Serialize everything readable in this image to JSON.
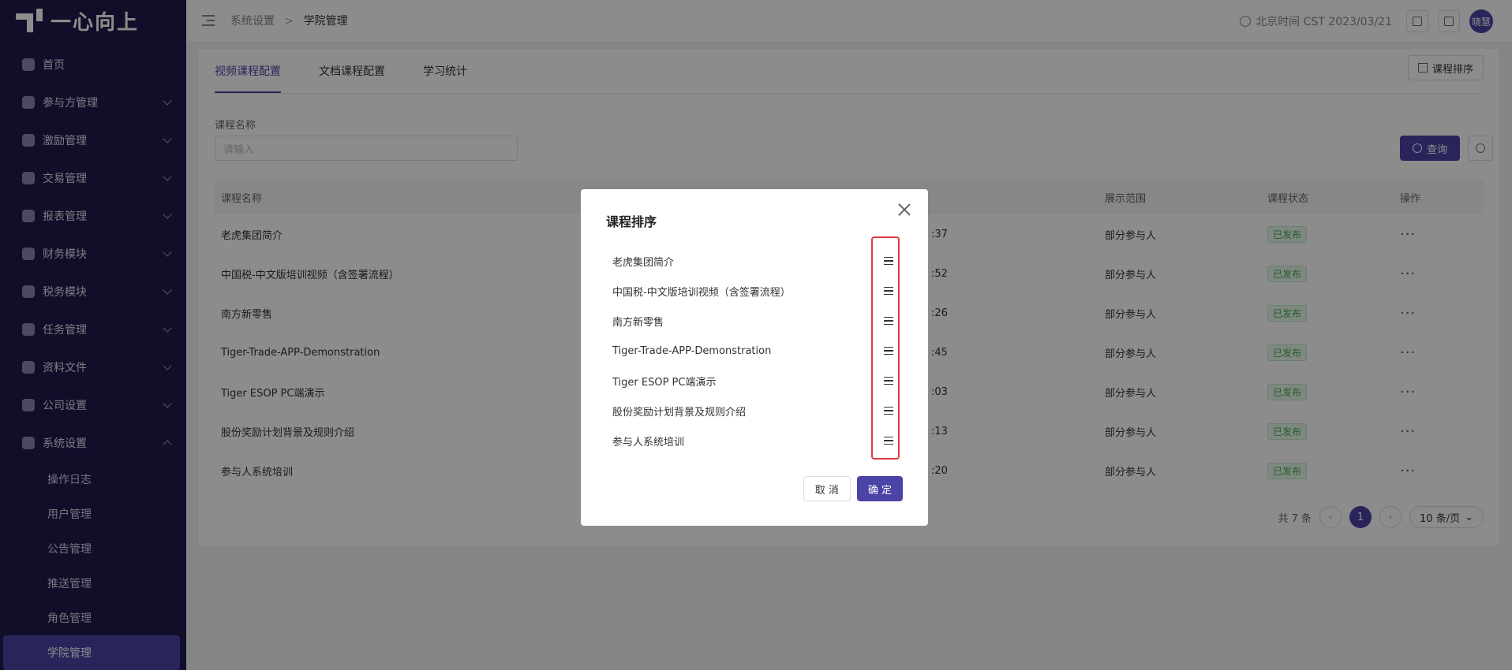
{
  "app": {
    "logo_text": "一心向上"
  },
  "sidebar": {
    "items": [
      {
        "label": "首页"
      },
      {
        "label": "参与方管理"
      },
      {
        "label": "激励管理"
      },
      {
        "label": "交易管理"
      },
      {
        "label": "报表管理"
      },
      {
        "label": "财务模块"
      },
      {
        "label": "税务模块"
      },
      {
        "label": "任务管理"
      },
      {
        "label": "资料文件"
      },
      {
        "label": "公司设置"
      },
      {
        "label": "系统设置"
      }
    ],
    "subitems": [
      {
        "label": "操作日志"
      },
      {
        "label": "用户管理"
      },
      {
        "label": "公告管理"
      },
      {
        "label": "推送管理"
      },
      {
        "label": "角色管理"
      },
      {
        "label": "学院管理"
      }
    ]
  },
  "header": {
    "breadcrumb_parent": "系统设置",
    "breadcrumb_sep": ">",
    "breadcrumb_current": "学院管理",
    "time": "北京时间 CST 2023/03/21",
    "avatar": "晓慧"
  },
  "tabs": [
    {
      "label": "视频课程配置"
    },
    {
      "label": "文档课程配置"
    },
    {
      "label": "学习统计"
    }
  ],
  "sort_button": "课程排序",
  "filter": {
    "label": "课程名称",
    "placeholder": "请输入"
  },
  "search_button": "查询",
  "table": {
    "headers": [
      "课程名称",
      "展示范围",
      "课程状态",
      "操作"
    ],
    "rows": [
      {
        "name": "老虎集团简介",
        "time": ":37",
        "scope": "部分参与人",
        "status": "已发布"
      },
      {
        "name": "中国税-中文版培训视频（含签署流程）",
        "time": ":52",
        "scope": "部分参与人",
        "status": "已发布"
      },
      {
        "name": "南方新零售",
        "time": ":26",
        "scope": "部分参与人",
        "status": "已发布"
      },
      {
        "name": "Tiger-Trade-APP-Demonstration",
        "time": ":45",
        "scope": "部分参与人",
        "status": "已发布"
      },
      {
        "name": "Tiger ESOP PC端演示",
        "time": ":03",
        "scope": "部分参与人",
        "status": "已发布"
      },
      {
        "name": "股份奖励计划背景及规则介绍",
        "time": ":13",
        "scope": "部分参与人",
        "status": "已发布"
      },
      {
        "name": "参与人系统培训",
        "time": ":20",
        "scope": "部分参与人",
        "status": "已发布"
      }
    ]
  },
  "pagination": {
    "total": "共 7 条",
    "current": "1",
    "page_size": "10 条/页"
  },
  "modal": {
    "title": "课程排序",
    "items": [
      "老虎集团简介",
      "中国税-中文版培训视频（含签署流程）",
      "南方新零售",
      "Tiger-Trade-APP-Demonstration",
      "Tiger ESOP PC端演示",
      "股份奖励计划背景及规则介绍",
      "参与人系统培训"
    ],
    "cancel": "取 消",
    "ok": "确 定"
  },
  "colors": {
    "primary": "#4b44a6",
    "sidebar_bg": "#1e1b4b",
    "success": "#3fae55",
    "highlight": "#e23b3b"
  }
}
